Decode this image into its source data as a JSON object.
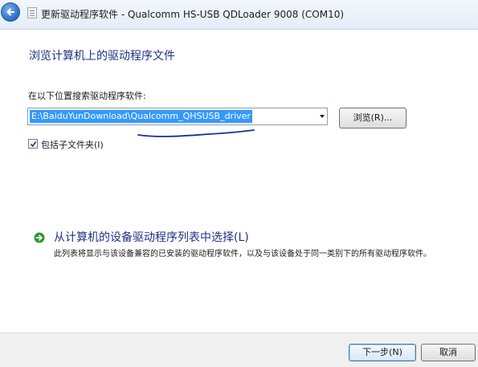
{
  "window": {
    "title": "更新驱动程序软件 - Qualcomm HS-USB QDLoader 9008 (COM10)"
  },
  "main": {
    "heading": "浏览计算机上的驱动程序文件",
    "search_label": "在以下位置搜索驱动程序软件:",
    "path_value": "E:\\BaiduYunDownload\\Qualcomm_QHSUSB_driver",
    "browse_label": "浏览(R)...",
    "include_subfolders_label": "包括子文件夹(I)",
    "include_subfolders_checked": true
  },
  "option": {
    "title": "从计算机的设备驱动程序列表中选择(L)",
    "description": "此列表将显示与该设备兼容的已安装的驱动程序软件，以及与该设备处于同一类别下的所有驱动程序软件。"
  },
  "footer": {
    "next_label": "下一步(N)",
    "cancel_label": "取消"
  },
  "colors": {
    "heading": "#1e3287",
    "selection": "#3399ff",
    "annotation_ink": "#1c2f8f",
    "arrow_green": "#2f9a2f"
  },
  "icons": {
    "back": "back-arrow-icon",
    "window": "driver-window-icon",
    "option": "green-arrow-icon",
    "check": "checkmark-icon"
  }
}
